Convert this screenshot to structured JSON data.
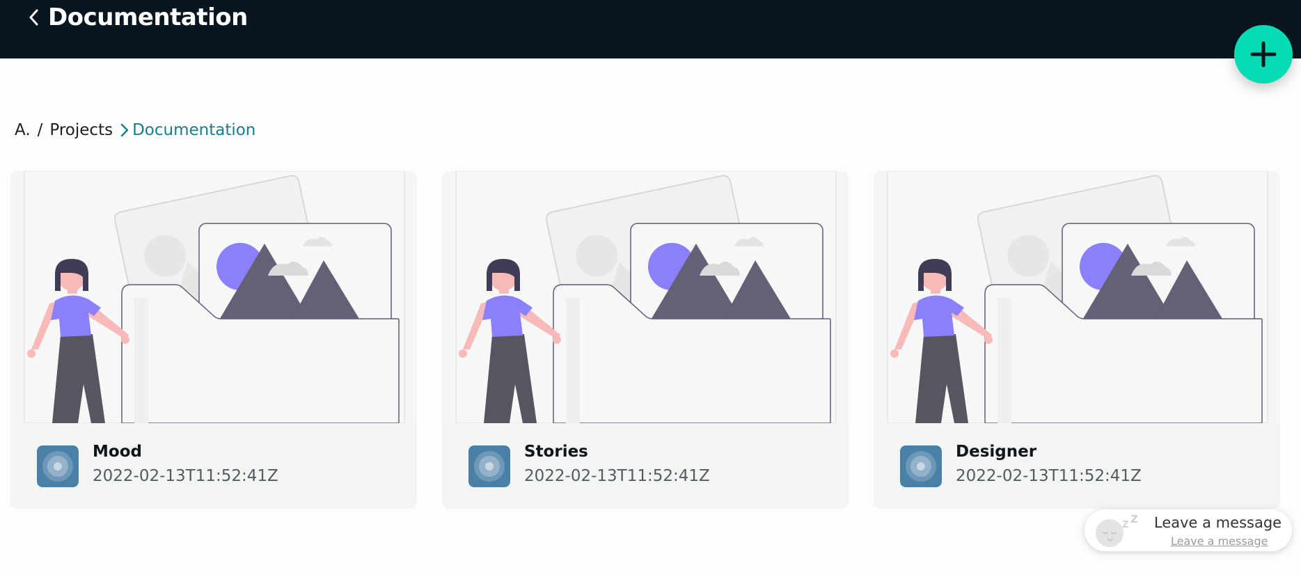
{
  "header": {
    "title": "Documentation",
    "back_icon": "chevron-left-icon",
    "background": "#081620"
  },
  "fab": {
    "icon": "plus-icon",
    "color": "#06dcb4"
  },
  "breadcrumb": {
    "items": [
      "A.",
      "Projects"
    ],
    "separator": "/",
    "current": "Documentation",
    "accent": "#1b7b8a"
  },
  "projects": [
    {
      "name": "Mood",
      "date": "2022-02-13T11:52:41Z"
    },
    {
      "name": "Stories",
      "date": "2022-02-13T11:52:41Z"
    },
    {
      "name": "Designer",
      "date": "2022-02-13T11:52:41Z"
    }
  ],
  "chat": {
    "title": "Leave a message",
    "link": "Leave a message",
    "icon": "sleeping-avatar-icon"
  }
}
